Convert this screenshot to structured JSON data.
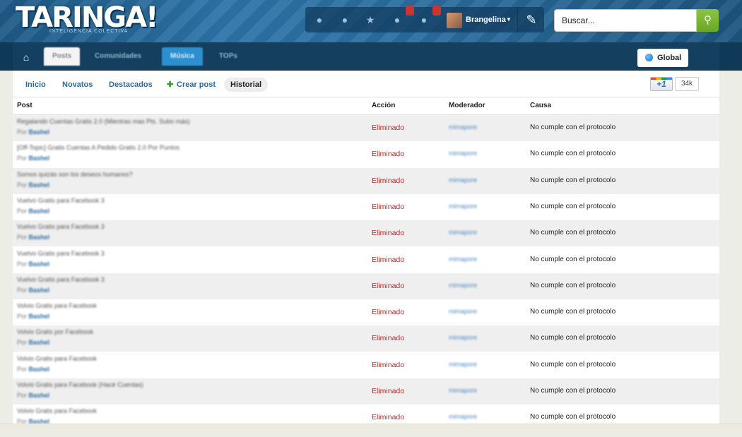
{
  "header": {
    "logo": "TARINGA!",
    "logo_tagline": "INTELIGENCIA COLECTIVA",
    "username": "Brangelina",
    "search": {
      "placeholder": "Buscar..."
    },
    "icons": [
      "eye-icon",
      "dot-icon",
      "star-icon",
      "bell-icon",
      "mail-icon",
      "compose-icon",
      "search-icon"
    ]
  },
  "nav": {
    "items": [
      {
        "label": "Posts"
      },
      {
        "label": "Comunidades"
      },
      {
        "label": "Música"
      },
      {
        "label": "TOPs"
      }
    ],
    "global_label": "Global"
  },
  "subnav": {
    "items": [
      {
        "label": "Inicio"
      },
      {
        "label": "Novatos"
      },
      {
        "label": "Destacados"
      },
      {
        "label": "Crear post"
      },
      {
        "label": "Historial"
      }
    ],
    "plus_one": "+1",
    "plus_one_count": "34k"
  },
  "table": {
    "headers": {
      "post": "Post",
      "accion": "Acción",
      "moderador": "Moderador",
      "causa": "Causa"
    },
    "rows": [
      {
        "title": "Regalando Cuentas Gratis 2.0 (Mientras mas Pts. Subo más)",
        "author_prefix": "Por",
        "author": "Bashel",
        "accion": "Eliminado",
        "moderador": "mimapore",
        "causa": "No cumple con el protocolo"
      },
      {
        "title": "[Off-Topic] Gratis Cuentas A Pedido Gratis 2.0 Por Puntos",
        "author_prefix": "Por",
        "author": "Bashel",
        "accion": "Eliminado",
        "moderador": "mimapore",
        "causa": "No cumple con el protocolo"
      },
      {
        "title": "Somos quizás son los deseos humanos?",
        "author_prefix": "Por",
        "author": "Bashel",
        "accion": "Eliminado",
        "moderador": "mimapore",
        "causa": "No cumple con el protocolo"
      },
      {
        "title": "Vuelvo Gratis para Facebook 3",
        "author_prefix": "Por",
        "author": "Bashel",
        "accion": "Eliminado",
        "moderador": "mimapore",
        "causa": "No cumple con el protocolo"
      },
      {
        "title": "Vuelvo Gratis para Facebook 3",
        "author_prefix": "Por",
        "author": "Bashel",
        "accion": "Eliminado",
        "moderador": "mimapore",
        "causa": "No cumple con el protocolo"
      },
      {
        "title": "Vuelvo Gratis para Facebook 3",
        "author_prefix": "Por",
        "author": "Bashel",
        "accion": "Eliminado",
        "moderador": "mimapore",
        "causa": "No cumple con el protocolo"
      },
      {
        "title": "Vuelvo Gratis para Facebook 3",
        "author_prefix": "Por",
        "author": "Bashel",
        "accion": "Eliminado",
        "moderador": "mimapore",
        "causa": "No cumple con el protocolo"
      },
      {
        "title": "Volvio Gratis para Facebook",
        "author_prefix": "Por",
        "author": "Bashel",
        "accion": "Eliminado",
        "moderador": "mimapore",
        "causa": "No cumple con el protocolo"
      },
      {
        "title": "Volvio Gratis por Facebook",
        "author_prefix": "Por",
        "author": "Bashel",
        "accion": "Eliminado",
        "moderador": "mimapore",
        "causa": "No cumple con el protocolo"
      },
      {
        "title": "Volvio Gratis para Facebook",
        "author_prefix": "Por",
        "author": "Bashel",
        "accion": "Eliminado",
        "moderador": "mimapore",
        "causa": "No cumple con el protocolo"
      },
      {
        "title": "Volvió Gratis para Facebook (Hacé Cuentas)",
        "author_prefix": "Por",
        "author": "Bashel",
        "accion": "Eliminado",
        "moderador": "mimapore",
        "causa": "No cumple con el protocolo"
      },
      {
        "title": "Volvio Gratis para Facebook",
        "author_prefix": "Por",
        "author": "Bashel",
        "accion": "Eliminado",
        "moderador": "mimapore",
        "causa": "No cumple con el protocolo"
      }
    ]
  },
  "colors": {
    "accent": "#2b6aa0",
    "danger": "#cc1f1f",
    "search_green": "#7ab83a"
  }
}
